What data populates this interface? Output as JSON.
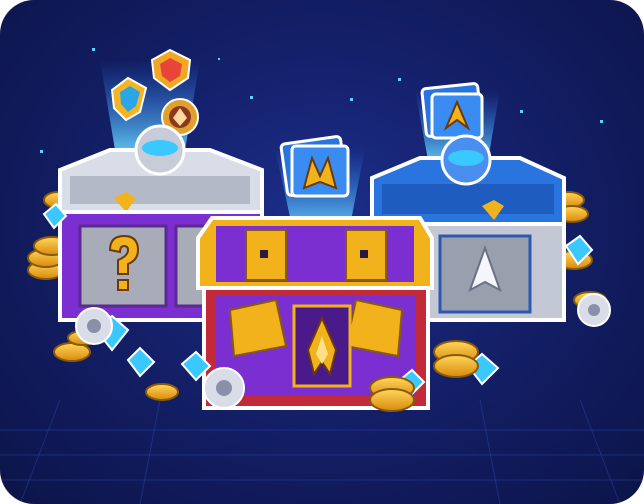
{
  "scene": {
    "description_tag": "",
    "chests": [
      {
        "id": "chest-mystery",
        "theme": "silver-purple",
        "emblem": "question-mark-icon",
        "hologram": [
          "shield-gem-icon",
          "heart-gem-icon",
          "rune-badge-icon"
        ]
      },
      {
        "id": "chest-epic",
        "theme": "purple-gold",
        "emblem": "flame-ship-icon",
        "hologram": [
          "ship-card-icon"
        ]
      },
      {
        "id": "chest-rare",
        "theme": "blue-silver",
        "emblem": "spaceship-icon",
        "hologram": [
          "ship-card-icon"
        ]
      }
    ],
    "loot": [
      "gold-coin-icon",
      "blue-crystal-icon",
      "gear-icon"
    ]
  },
  "colors": {
    "background_dark": "#0c1448",
    "background_mid": "#1c2f8c",
    "glow_cyan": "#39c8ff",
    "gold": "#f2b21c",
    "purple": "#7b2fd0",
    "silver": "#d9dde8",
    "blue_chest": "#2a74e0",
    "outline": "#ffffff"
  }
}
